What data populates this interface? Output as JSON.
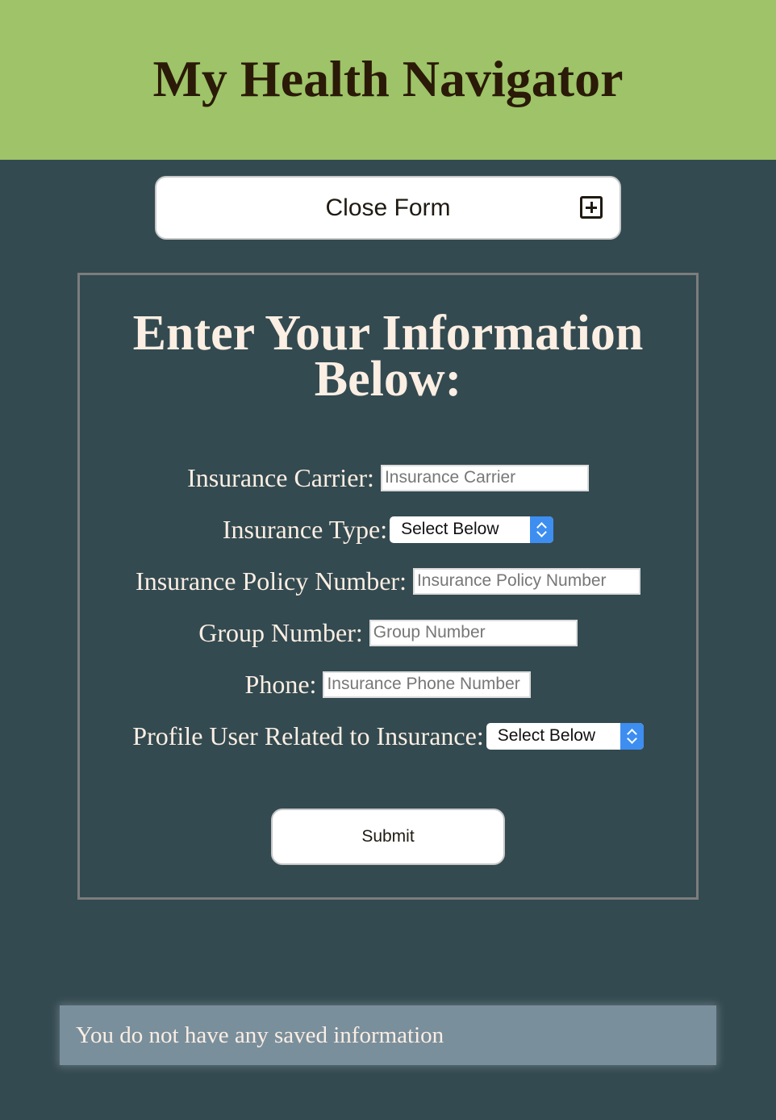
{
  "header": {
    "title": "My Health Navigator"
  },
  "toggle": {
    "label": "Close Form",
    "icon": "plus-square-icon"
  },
  "form": {
    "title": "Enter Your Information Below:",
    "fields": {
      "carrier": {
        "label": "Insurance Carrier:",
        "placeholder": "Insurance Carrier",
        "value": ""
      },
      "type": {
        "label": "Insurance Type:",
        "selected": "Select Below"
      },
      "policy": {
        "label": "Insurance Policy Number:",
        "placeholder": "Insurance Policy Number",
        "value": ""
      },
      "group": {
        "label": "Group Number:",
        "placeholder": "Group Number",
        "value": ""
      },
      "phone": {
        "label": "Phone:",
        "placeholder": "Insurance Phone Number",
        "value": ""
      },
      "profile_user": {
        "label": "Profile User Related to Insurance:",
        "selected": "Select Below"
      }
    },
    "submit_label": "Submit"
  },
  "saved": {
    "message": "You do not have any saved information"
  },
  "colors": {
    "header_bg": "#9ec368",
    "page_bg": "#334a50",
    "select_accent": "#3d8ef0",
    "notice_bg": "#7a8f9c"
  }
}
